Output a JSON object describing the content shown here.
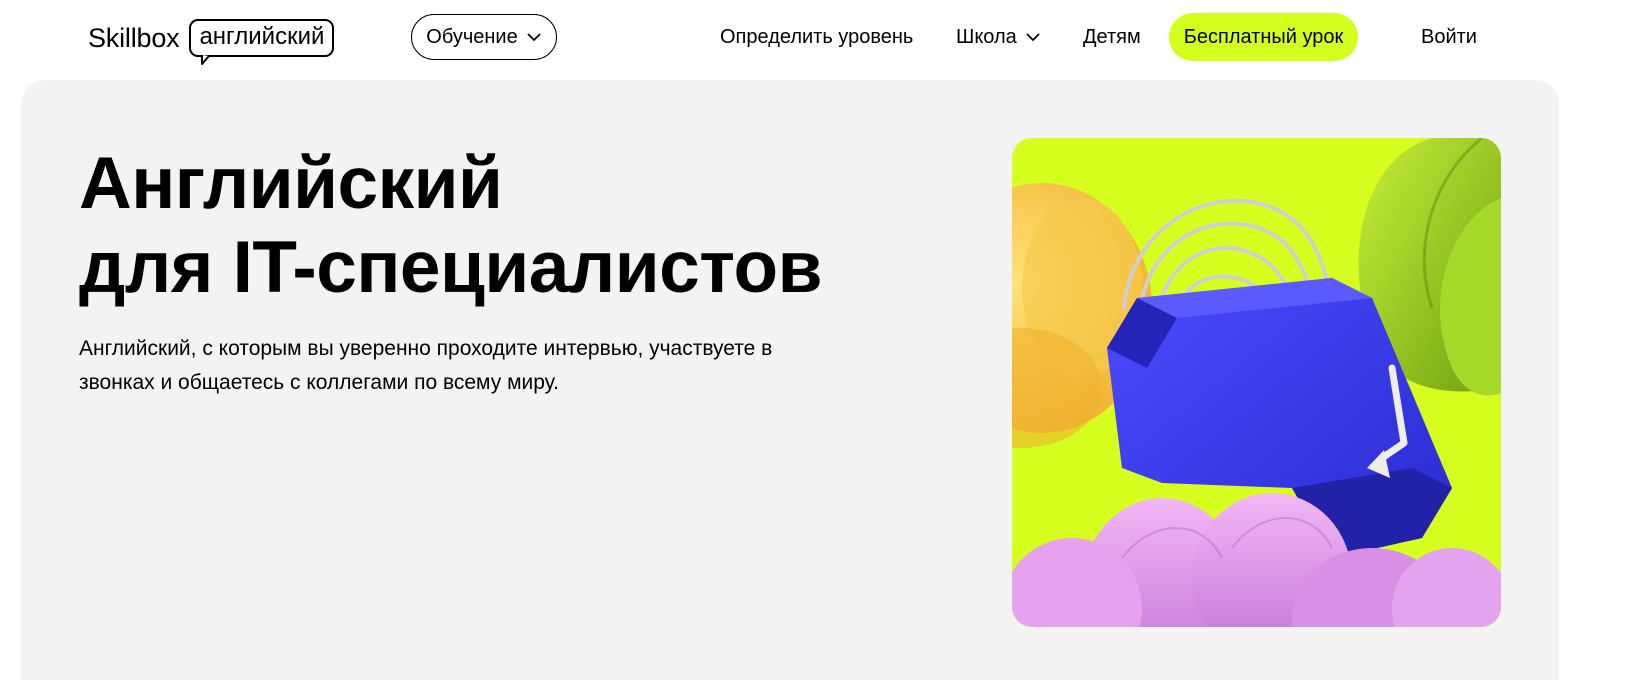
{
  "header": {
    "logo_word": "Skillbox",
    "logo_tag": "английский",
    "learn_label": "Обучение",
    "nav": {
      "level": "Определить уровень",
      "school": "Школа",
      "kids": "Детям",
      "free_lesson": "Бесплатный урок",
      "login": "Войти"
    }
  },
  "hero": {
    "title": "Английский\nдля IT-специалистов",
    "subtitle": "Английский, с которым вы уверенно проходите интервью, участвуете в звонках и общаетесь с коллегами по всему миру."
  },
  "colors": {
    "accent": "#d4ff1e",
    "hero_bg": "#f3f3f3",
    "key_blue": "#3a3ae6"
  },
  "icons": {
    "chevron": "chevron-down-icon"
  }
}
